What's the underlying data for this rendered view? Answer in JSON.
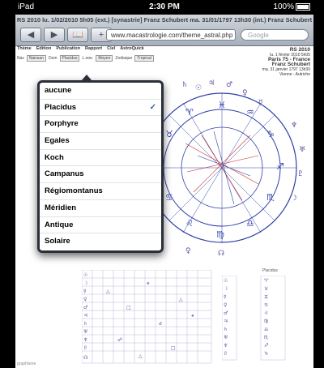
{
  "status": {
    "carrier": "iPad",
    "time": "2:30 PM",
    "battery": "100%"
  },
  "browser": {
    "title": "RS 2010 lu. 1/02/2010 5h05 (ext.) [synastrie] Franz Schubert ma. 31/01/1797 13h30 (int.) Franz Schubert",
    "url": "www.macastrologie.com/theme_astral.php",
    "search_placeholder": "Google",
    "nav": {
      "back": "◀",
      "forward": "▶",
      "bookmarks": "📖",
      "add": "+"
    }
  },
  "page": {
    "menu": [
      "Thème",
      "Edition",
      "Publication",
      "Rapport",
      "Ciel",
      "AstroQuick"
    ],
    "toolbar": {
      "nav_label": "Nav",
      "nav_value": "Naissan",
      "dom_label": "Dom",
      "dom_value": "Placidus",
      "lunar_label": "L.noe.",
      "lunar_value": "Moyen",
      "zodiac_label": "Zodiaque",
      "zodiac_value": "Tropical"
    },
    "info": {
      "rs": "RS 2010",
      "date1": "lu. 1 février 2010 5h05",
      "place1": "Paris 75 - France",
      "person": "Franz Schubert",
      "date2": "ma. 31 janvier 1797 13h30",
      "place2": "Vienne - Autriche"
    },
    "side_title": "Placidus",
    "footer": "graphisme"
  },
  "house_systems": {
    "items": [
      "aucune",
      "Placidus",
      "Porphyre",
      "Egales",
      "Koch",
      "Campanus",
      "Régiomontanus",
      "Méridien",
      "Antique",
      "Solaire"
    ],
    "selected": "Placidus",
    "check": "✓"
  },
  "colors": {
    "accent": "#3a5fa0",
    "popover": "#2a2f39",
    "chart_blue": "#2d3fa8",
    "chart_red": "#c43030"
  }
}
